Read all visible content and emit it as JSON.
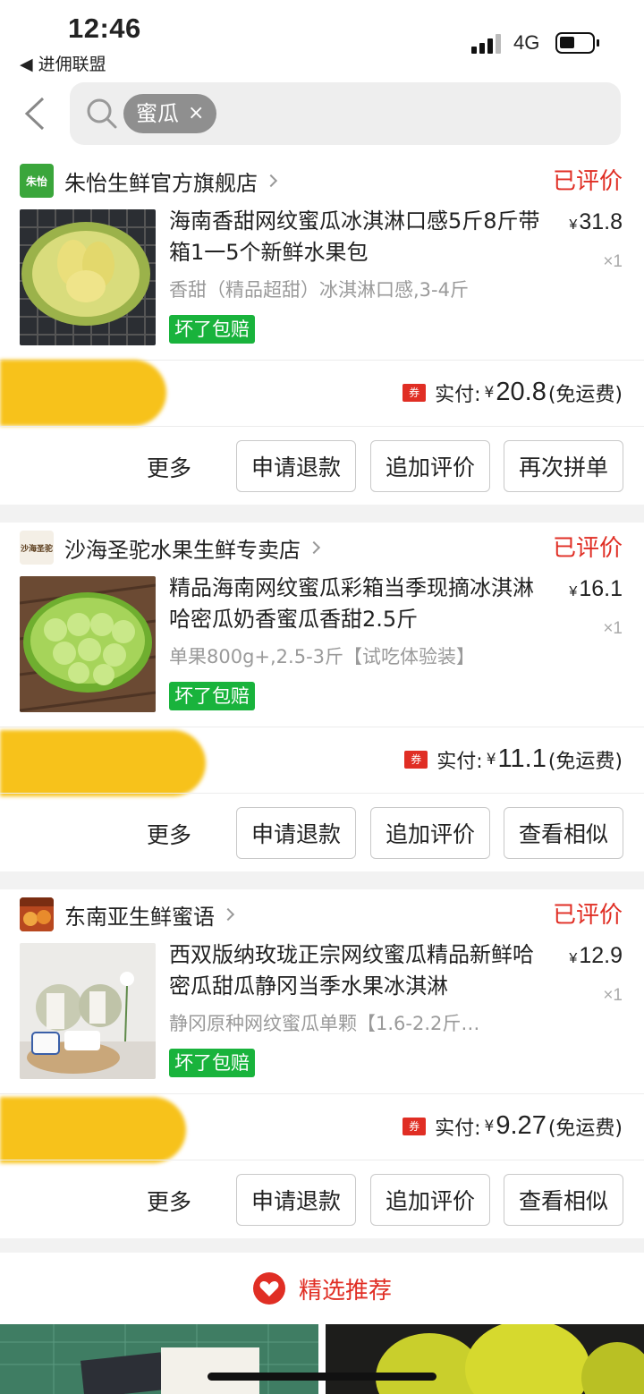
{
  "status_bar": {
    "time": "12:46",
    "back_app": "◀ 进佣联盟",
    "network": "4G"
  },
  "search": {
    "chip_text": "蜜瓜",
    "chip_close": "×"
  },
  "orders": [
    {
      "shop_logo_text": "朱怡",
      "shop_name": "朱怡生鲜官方旗舰店",
      "status": "已评价",
      "title": "海南香甜网纹蜜瓜冰淇淋口感5斤8斤带箱1一5个新鲜水果包",
      "spec": "香甜（精品超甜）冰淇淋口感,3-4斤",
      "tag": "坏了包赔",
      "price_symbol": "¥",
      "price": "31.8",
      "qty": "×1",
      "coupon": "券",
      "paid_label": "实付:",
      "paid_symbol": "¥",
      "paid_amount": "20.8",
      "shipping": "(免运费)",
      "more": "更多",
      "buttons": [
        "申请退款",
        "追加评价",
        "再次拼单"
      ]
    },
    {
      "shop_logo_text": "沙海圣驼",
      "shop_name": "沙海圣驼水果生鲜专卖店",
      "status": "已评价",
      "title": "精品海南网纹蜜瓜彩箱当季现摘冰淇淋哈密瓜奶香蜜瓜香甜2.5斤",
      "spec": "单果800g+,2.5-3斤【试吃体验装】",
      "tag": "坏了包赔",
      "price_symbol": "¥",
      "price": "16.1",
      "qty": "×1",
      "coupon": "券",
      "paid_label": "实付:",
      "paid_symbol": "¥",
      "paid_amount": "11.1",
      "shipping": "(免运费)",
      "more": "更多",
      "buttons": [
        "申请退款",
        "追加评价",
        "查看相似"
      ]
    },
    {
      "shop_logo_text": "",
      "shop_name": "东南亚生鲜蜜语",
      "status": "已评价",
      "title": "西双版纳玫珑正宗网纹蜜瓜精品新鲜哈密瓜甜瓜静冈当季水果冰淇淋",
      "spec": "静冈原种网纹蜜瓜单颗【1.6-2.2斤…",
      "tag": "坏了包赔",
      "price_symbol": "¥",
      "price": "12.9",
      "qty": "×1",
      "coupon": "券",
      "paid_label": "实付:",
      "paid_symbol": "¥",
      "paid_amount": "9.27",
      "shipping": "(免运费)",
      "more": "更多",
      "buttons": [
        "申请退款",
        "追加评价",
        "查看相似"
      ]
    }
  ],
  "recommend": {
    "label": "精选推荐"
  },
  "colors": {
    "accent_red": "#e02e24",
    "tag_green": "#19b33c"
  }
}
